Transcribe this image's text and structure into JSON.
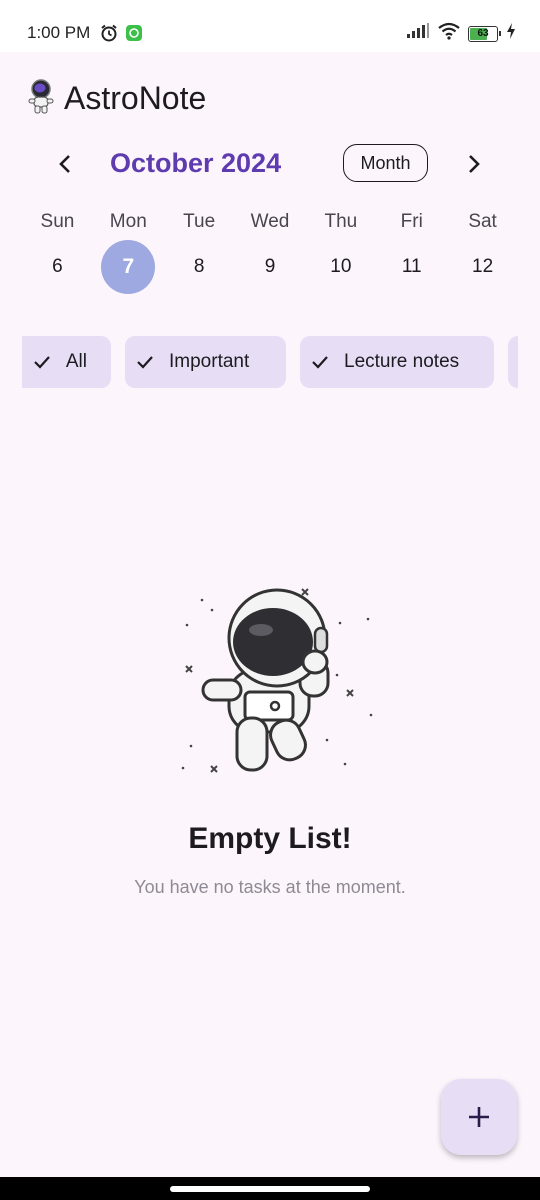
{
  "status": {
    "time": "1:00 PM",
    "icons": [
      "alarm-icon",
      "app-notification-icon",
      "signal-icon",
      "wifi-icon",
      "battery-icon",
      "charging-icon"
    ],
    "battery_level": "63"
  },
  "app": {
    "name": "AstroNote",
    "logo": "astronaut-logo-icon"
  },
  "calendar": {
    "month_title": "October 2024",
    "view_button": "Month",
    "days": [
      {
        "name": "Sun",
        "num": "6"
      },
      {
        "name": "Mon",
        "num": "7"
      },
      {
        "name": "Tue",
        "num": "8"
      },
      {
        "name": "Wed",
        "num": "9"
      },
      {
        "name": "Thu",
        "num": "10"
      },
      {
        "name": "Fri",
        "num": "11"
      },
      {
        "name": "Sat",
        "num": "12"
      }
    ],
    "selected_day": "7"
  },
  "filters": [
    {
      "label": "All"
    },
    {
      "label": "Important"
    },
    {
      "label": "Lecture notes"
    }
  ],
  "empty_state": {
    "title": "Empty List!",
    "subtitle": "You have no tasks at the moment.",
    "illustration": "astronaut-icon"
  },
  "fab": {
    "icon": "plus-icon"
  },
  "colors": {
    "background": "#FDF5FC",
    "accent": "#5E3BAE",
    "chip": "#E7DEF6",
    "selected_day": "#9DA9E0"
  }
}
